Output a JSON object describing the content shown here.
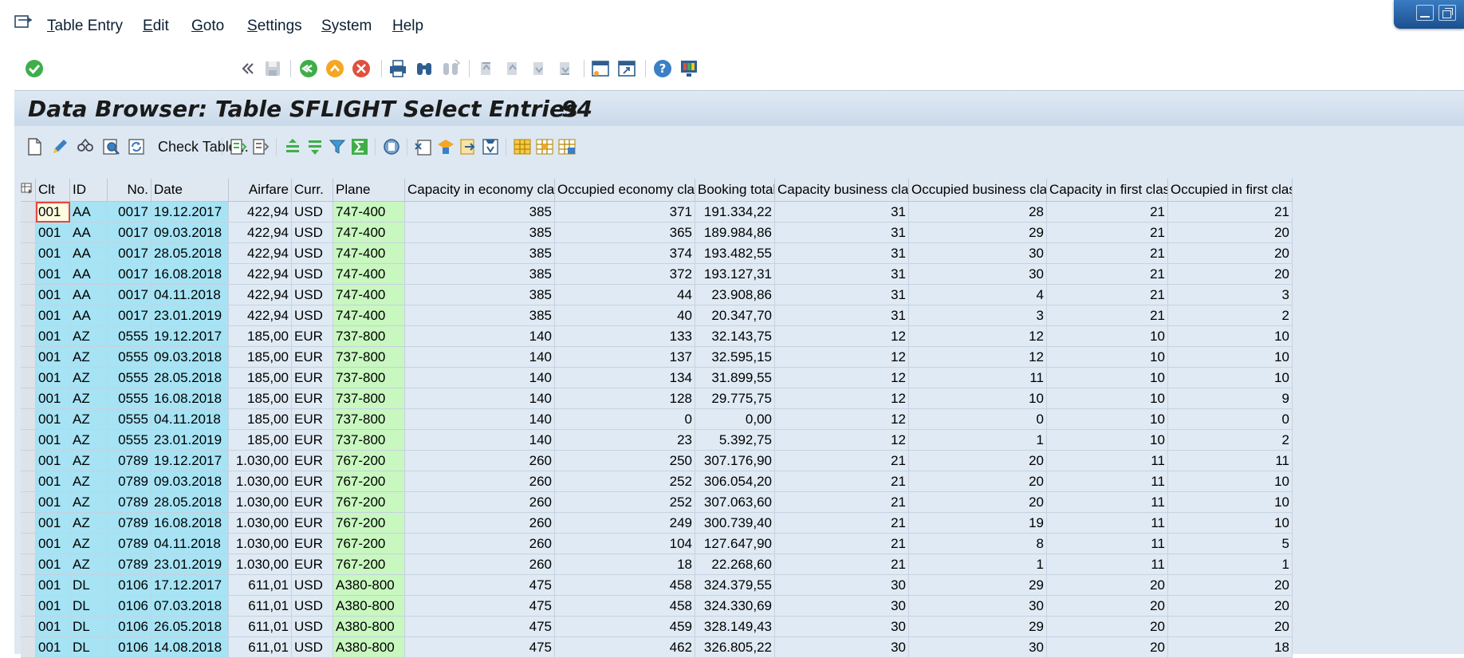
{
  "menu": {
    "items": [
      {
        "acc": "T",
        "rest": "able Entry"
      },
      {
        "acc": "E",
        "rest": "dit"
      },
      {
        "acc": "G",
        "rest": "oto"
      },
      {
        "acc": "S",
        "rest": "ettings"
      },
      {
        "acc": "S",
        "rest": "ystem"
      },
      {
        "acc": "H",
        "rest": "elp"
      }
    ]
  },
  "toolbar": {
    "command_value": "",
    "icons": [
      "enter-icon",
      "back-double-arrow-icon",
      "save-icon",
      "back-icon",
      "exit-icon",
      "cancel-icon",
      "print-icon",
      "find-icon",
      "find-next-icon",
      "first-page-icon",
      "previous-page-icon",
      "next-page-icon",
      "last-page-icon",
      "create-session-icon",
      "shortcut-icon",
      "help-icon",
      "customize-layout-icon"
    ]
  },
  "title": {
    "text": "Data Browser: Table SFLIGHT Select Entries",
    "count": "94"
  },
  "app_toolbar": {
    "check_table_label": "Check Table..."
  },
  "table": {
    "columns": [
      "Clt",
      "ID",
      "No.",
      "Date",
      "Airfare",
      "Curr.",
      "Plane",
      "Capacity in economy class",
      "Occupied economy class",
      "Booking total",
      "Capacity business class",
      "Occupied business class",
      "Capacity in first class",
      "Occupied in first class"
    ],
    "rows": [
      [
        "001",
        "AA",
        "0017",
        "19.12.2017",
        "422,94",
        "USD",
        "747-400",
        "385",
        "371",
        "191.334,22",
        "31",
        "28",
        "21",
        "21"
      ],
      [
        "001",
        "AA",
        "0017",
        "09.03.2018",
        "422,94",
        "USD",
        "747-400",
        "385",
        "365",
        "189.984,86",
        "31",
        "29",
        "21",
        "20"
      ],
      [
        "001",
        "AA",
        "0017",
        "28.05.2018",
        "422,94",
        "USD",
        "747-400",
        "385",
        "374",
        "193.482,55",
        "31",
        "30",
        "21",
        "20"
      ],
      [
        "001",
        "AA",
        "0017",
        "16.08.2018",
        "422,94",
        "USD",
        "747-400",
        "385",
        "372",
        "193.127,31",
        "31",
        "30",
        "21",
        "20"
      ],
      [
        "001",
        "AA",
        "0017",
        "04.11.2018",
        "422,94",
        "USD",
        "747-400",
        "385",
        "44",
        "23.908,86",
        "31",
        "4",
        "21",
        "3"
      ],
      [
        "001",
        "AA",
        "0017",
        "23.01.2019",
        "422,94",
        "USD",
        "747-400",
        "385",
        "40",
        "20.347,70",
        "31",
        "3",
        "21",
        "2"
      ],
      [
        "001",
        "AZ",
        "0555",
        "19.12.2017",
        "185,00",
        "EUR",
        "737-800",
        "140",
        "133",
        "32.143,75",
        "12",
        "12",
        "10",
        "10"
      ],
      [
        "001",
        "AZ",
        "0555",
        "09.03.2018",
        "185,00",
        "EUR",
        "737-800",
        "140",
        "137",
        "32.595,15",
        "12",
        "12",
        "10",
        "10"
      ],
      [
        "001",
        "AZ",
        "0555",
        "28.05.2018",
        "185,00",
        "EUR",
        "737-800",
        "140",
        "134",
        "31.899,55",
        "12",
        "11",
        "10",
        "10"
      ],
      [
        "001",
        "AZ",
        "0555",
        "16.08.2018",
        "185,00",
        "EUR",
        "737-800",
        "140",
        "128",
        "29.775,75",
        "12",
        "10",
        "10",
        "9"
      ],
      [
        "001",
        "AZ",
        "0555",
        "04.11.2018",
        "185,00",
        "EUR",
        "737-800",
        "140",
        "0",
        "0,00",
        "12",
        "0",
        "10",
        "0"
      ],
      [
        "001",
        "AZ",
        "0555",
        "23.01.2019",
        "185,00",
        "EUR",
        "737-800",
        "140",
        "23",
        "5.392,75",
        "12",
        "1",
        "10",
        "2"
      ],
      [
        "001",
        "AZ",
        "0789",
        "19.12.2017",
        "1.030,00",
        "EUR",
        "767-200",
        "260",
        "250",
        "307.176,90",
        "21",
        "20",
        "11",
        "11"
      ],
      [
        "001",
        "AZ",
        "0789",
        "09.03.2018",
        "1.030,00",
        "EUR",
        "767-200",
        "260",
        "252",
        "306.054,20",
        "21",
        "20",
        "11",
        "10"
      ],
      [
        "001",
        "AZ",
        "0789",
        "28.05.2018",
        "1.030,00",
        "EUR",
        "767-200",
        "260",
        "252",
        "307.063,60",
        "21",
        "20",
        "11",
        "10"
      ],
      [
        "001",
        "AZ",
        "0789",
        "16.08.2018",
        "1.030,00",
        "EUR",
        "767-200",
        "260",
        "249",
        "300.739,40",
        "21",
        "19",
        "11",
        "10"
      ],
      [
        "001",
        "AZ",
        "0789",
        "04.11.2018",
        "1.030,00",
        "EUR",
        "767-200",
        "260",
        "104",
        "127.647,90",
        "21",
        "8",
        "11",
        "5"
      ],
      [
        "001",
        "AZ",
        "0789",
        "23.01.2019",
        "1.030,00",
        "EUR",
        "767-200",
        "260",
        "18",
        "22.268,60",
        "21",
        "1",
        "11",
        "1"
      ],
      [
        "001",
        "DL",
        "0106",
        "17.12.2017",
        "611,01",
        "USD",
        "A380-800",
        "475",
        "458",
        "324.379,55",
        "30",
        "29",
        "20",
        "20"
      ],
      [
        "001",
        "DL",
        "0106",
        "07.03.2018",
        "611,01",
        "USD",
        "A380-800",
        "475",
        "458",
        "324.330,69",
        "30",
        "30",
        "20",
        "20"
      ],
      [
        "001",
        "DL",
        "0106",
        "26.05.2018",
        "611,01",
        "USD",
        "A380-800",
        "475",
        "459",
        "328.149,43",
        "30",
        "29",
        "20",
        "20"
      ],
      [
        "001",
        "DL",
        "0106",
        "14.08.2018",
        "611,01",
        "USD",
        "A380-800",
        "475",
        "462",
        "326.805,22",
        "30",
        "30",
        "20",
        "18"
      ]
    ]
  },
  "colors": {
    "key_column": "#a6e3f4",
    "plane_column": "#c8f7c0",
    "data_column": "#dfeaf4",
    "title_band": "#c9d9ea"
  }
}
